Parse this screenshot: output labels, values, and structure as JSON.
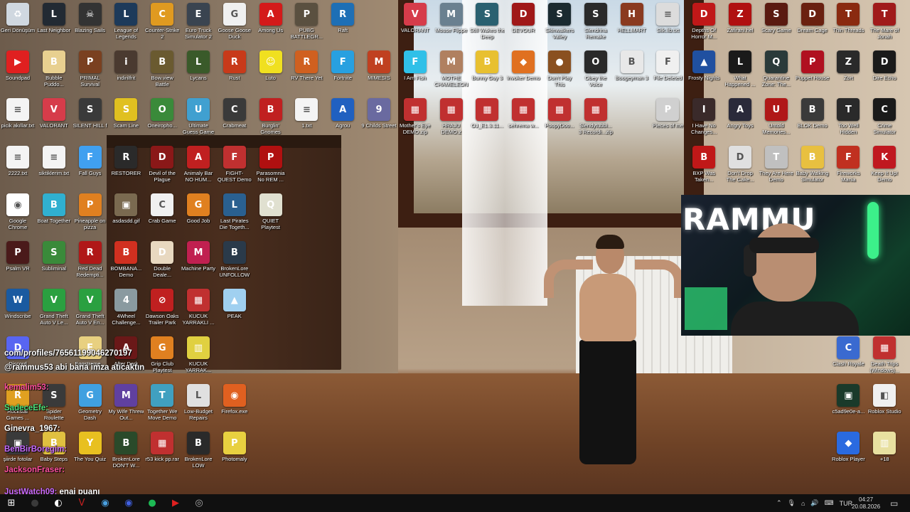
{
  "colors": {
    "taskbar": "#101010",
    "icon_label": "#ffffff",
    "chat_pink": "#ff4fa0",
    "chat_green": "#4be07a",
    "chat_blue": "#4ab0ff",
    "chat_white": "#ffffff",
    "chat_purple": "#c86bff"
  },
  "icons": [
    {
      "label": "Geri Dönüşüm",
      "col": 0,
      "row": 0,
      "color": "#d0d8e0",
      "glyph": "♻"
    },
    {
      "label": "Last Neighbor",
      "col": 1,
      "row": 0,
      "color": "#222a33",
      "glyph": "L"
    },
    {
      "label": "Blazing Sails",
      "col": 2,
      "row": 0,
      "color": "#333",
      "glyph": "☠"
    },
    {
      "label": "League of Legends",
      "col": 3,
      "row": 0,
      "color": "#1d3a5a",
      "glyph": "L"
    },
    {
      "label": "Counter-Strike 2",
      "col": 4,
      "row": 0,
      "color": "#e09a20",
      "glyph": "C"
    },
    {
      "label": "Euro Truck Simulator 2",
      "col": 5,
      "row": 0,
      "color": "#3a4450",
      "glyph": "E"
    },
    {
      "label": "Goose Goose Duck",
      "col": 6,
      "row": 0,
      "color": "#f0f0f0",
      "glyph": "G"
    },
    {
      "label": "Among Us",
      "col": 7,
      "row": 0,
      "color": "#d41a1a",
      "glyph": "A"
    },
    {
      "label": "PUBG BATTLEGR...",
      "col": 8,
      "row": 0,
      "color": "#5a5040",
      "glyph": "P"
    },
    {
      "label": "Raft",
      "col": 9,
      "row": 0,
      "color": "#1e6fb5",
      "glyph": "R"
    },
    {
      "label": "VALORANT",
      "col": 11,
      "row": 0,
      "color": "#d63c4a",
      "glyph": "V"
    },
    {
      "label": "Mouse Flippe",
      "col": 12,
      "row": 0,
      "color": "#6a8090",
      "glyph": "M"
    },
    {
      "label": "Still Wakes the Deep",
      "col": 13,
      "row": 0,
      "color": "#2a6070",
      "glyph": "S"
    },
    {
      "label": "DEVOUR",
      "col": 14,
      "row": 0,
      "color": "#a01818",
      "glyph": "D"
    },
    {
      "label": "Skinwalkers Valley",
      "col": 15,
      "row": 0,
      "color": "#1a2a30",
      "glyph": "S"
    },
    {
      "label": "Slendrina Remake",
      "col": 16,
      "row": 0,
      "color": "#2a2a2a",
      "glyph": "S"
    },
    {
      "label": "HELLMART",
      "col": 17,
      "row": 0,
      "color": "#8a3a20",
      "glyph": "H"
    },
    {
      "label": "Silk.lib.txt",
      "col": 18,
      "row": 0,
      "color": "#dcdcdc",
      "glyph": "≡"
    },
    {
      "label": "Depths Of Horror M...",
      "col": 19,
      "row": 0,
      "color": "#c01818",
      "glyph": "D"
    },
    {
      "label": "Zafirani.hel",
      "col": 20,
      "row": 0,
      "color": "#b01010",
      "glyph": "Z"
    },
    {
      "label": "Scary Game",
      "col": 21,
      "row": 0,
      "color": "#5a1a10",
      "glyph": "S"
    },
    {
      "label": "Dream Cage",
      "col": 22,
      "row": 0,
      "color": "#6a2010",
      "glyph": "D"
    },
    {
      "label": "Thin Threads",
      "col": 23,
      "row": 0,
      "color": "#8a2a10",
      "glyph": "T"
    },
    {
      "label": "The Mare of Jonah",
      "col": 24,
      "row": 0,
      "color": "#a01a1a",
      "glyph": "T"
    },
    {
      "label": "Soundpad",
      "col": 0,
      "row": 1,
      "color": "#e02020",
      "glyph": "▶"
    },
    {
      "label": "Bubble Puddo...",
      "col": 1,
      "row": 1,
      "color": "#e8d090",
      "glyph": "B"
    },
    {
      "label": "PRIMAL Survival",
      "col": 2,
      "row": 1,
      "color": "#7a4020",
      "glyph": "P"
    },
    {
      "label": "indirilfrit",
      "col": 3,
      "row": 1,
      "color": "#4a3a30",
      "glyph": "i"
    },
    {
      "label": "Bow.view Battle",
      "col": 4,
      "row": 1,
      "color": "#6a5a30",
      "glyph": "B"
    },
    {
      "label": "Lycans",
      "col": 5,
      "row": 1,
      "color": "#3a5a2a",
      "glyph": "L"
    },
    {
      "label": "Rust",
      "col": 6,
      "row": 1,
      "color": "#c83a1a",
      "glyph": "R"
    },
    {
      "label": "Luto",
      "col": 7,
      "row": 1,
      "color": "#f0e020",
      "glyph": "☺"
    },
    {
      "label": "RV There Yet",
      "col": 8,
      "row": 1,
      "color": "#d06020",
      "glyph": "R"
    },
    {
      "label": "Fortnite",
      "col": 9,
      "row": 1,
      "color": "#28a0e0",
      "glyph": "F"
    },
    {
      "label": "MIMESIS",
      "col": 10,
      "row": 1,
      "color": "#c04020",
      "glyph": "M"
    },
    {
      "label": "I Am Fish",
      "col": 11,
      "row": 1,
      "color": "#30c0e8",
      "glyph": "F"
    },
    {
      "label": "MOTHE CHAMELEON",
      "col": 12,
      "row": 1,
      "color": "#b08060",
      "glyph": "M"
    },
    {
      "label": "Bunny Guy 3",
      "col": 13,
      "row": 1,
      "color": "#e8c030",
      "glyph": "B"
    },
    {
      "label": "Invoker Demo",
      "col": 14,
      "row": 1,
      "color": "#e07020",
      "glyph": "◆"
    },
    {
      "label": "Don't Play This",
      "col": 15,
      "row": 1,
      "color": "#8a5020",
      "glyph": "●"
    },
    {
      "label": "Obey the Voice",
      "col": 16,
      "row": 1,
      "color": "#2a2a2a",
      "glyph": "O"
    },
    {
      "label": "Boogeyman 3",
      "col": 17,
      "row": 1,
      "color": "#e8e8e8",
      "glyph": "B"
    },
    {
      "label": "File Deleted",
      "col": 18,
      "row": 1,
      "color": "#f0f0f0",
      "glyph": "F"
    },
    {
      "label": "Frosty Nights",
      "col": 19,
      "row": 1,
      "color": "#2050a0",
      "glyph": "▲"
    },
    {
      "label": "What Happened ...",
      "col": 20,
      "row": 1,
      "color": "#1a1a1a",
      "glyph": "L"
    },
    {
      "label": "Quarantine Zone: The...",
      "col": 21,
      "row": 1,
      "color": "#2a3a3a",
      "glyph": "Q"
    },
    {
      "label": "Puppet House",
      "col": 22,
      "row": 1,
      "color": "#b01020",
      "glyph": "P"
    },
    {
      "label": "Zort",
      "col": 23,
      "row": 1,
      "color": "#2a2a2a",
      "glyph": "Z"
    },
    {
      "label": "Dire Echo",
      "col": 24,
      "row": 1,
      "color": "#1a1a1a",
      "glyph": "D"
    },
    {
      "label": "picik akıllar.txt",
      "col": 0,
      "row": 2,
      "color": "#f4f4f4",
      "glyph": "≡"
    },
    {
      "label": "VALORANT",
      "col": 1,
      "row": 2,
      "color": "#d63c4a",
      "glyph": "V"
    },
    {
      "label": "SILENT HILL f",
      "col": 2,
      "row": 2,
      "color": "#3a3a3a",
      "glyph": "S"
    },
    {
      "label": "Scam Line",
      "col": 3,
      "row": 2,
      "color": "#e0c020",
      "glyph": "S"
    },
    {
      "label": "Oneiropho...",
      "col": 4,
      "row": 2,
      "color": "#3a8a3a",
      "glyph": "O"
    },
    {
      "label": "Ultimate Guess Game",
      "col": 5,
      "row": 2,
      "color": "#40a0d0",
      "glyph": "U"
    },
    {
      "label": "Crabmeat",
      "col": 6,
      "row": 2,
      "color": "#3a3a3a",
      "glyph": "C"
    },
    {
      "label": "Burglin' Gnomes",
      "col": 7,
      "row": 2,
      "color": "#c02020",
      "glyph": "B"
    },
    {
      "label": "1.txt",
      "col": 8,
      "row": 2,
      "color": "#f4f4f4",
      "glyph": "≡"
    },
    {
      "label": "Agrou",
      "col": 9,
      "row": 2,
      "color": "#2060c0",
      "glyph": "A"
    },
    {
      "label": "9 Childs Street",
      "col": 10,
      "row": 2,
      "color": "#6a6aa0",
      "glyph": "9"
    },
    {
      "label": "Mother's Eye DEMO.zip",
      "col": 11,
      "row": 2,
      "color": "#c03030",
      "glyph": "▦"
    },
    {
      "label": "HRAJU DEMO.z",
      "col": 12,
      "row": 2,
      "color": "#c03030",
      "glyph": "▦"
    },
    {
      "label": "OJ_E1.3.11...",
      "col": 13,
      "row": 2,
      "color": "#c03030",
      "glyph": "▦"
    },
    {
      "label": "sehrema w...",
      "col": 14,
      "row": 2,
      "color": "#c03030",
      "glyph": "▦"
    },
    {
      "label": "PoopyDoo...",
      "col": 15,
      "row": 2,
      "color": "#c03030",
      "glyph": "▦"
    },
    {
      "label": "Slendytubbi... 3 Recordi...zip",
      "col": 16,
      "row": 2,
      "color": "#c03030",
      "glyph": "▦"
    },
    {
      "label": "Pieces of me",
      "col": 18,
      "row": 2,
      "color": "#d0d0d0",
      "glyph": "P"
    },
    {
      "label": "I Have No Changes...",
      "col": 19,
      "row": 2,
      "color": "#3a2a2a",
      "glyph": "I"
    },
    {
      "label": "Angry Toys",
      "col": 20,
      "row": 2,
      "color": "#2a2a3a",
      "glyph": "A"
    },
    {
      "label": "Untold Memories...",
      "col": 21,
      "row": 2,
      "color": "#b01818",
      "glyph": "U"
    },
    {
      "label": "BLOK Demo",
      "col": 22,
      "row": 2,
      "color": "#3a3a3a",
      "glyph": "B"
    },
    {
      "label": "Too Well Hidden",
      "col": 23,
      "row": 2,
      "color": "#2a2a2a",
      "glyph": "T"
    },
    {
      "label": "Crime Simulator",
      "col": 24,
      "row": 2,
      "color": "#1a1a1a",
      "glyph": "C"
    },
    {
      "label": "2222.txt",
      "col": 0,
      "row": 3,
      "color": "#f4f4f4",
      "glyph": "≡"
    },
    {
      "label": "siktiklerim.txt",
      "col": 1,
      "row": 3,
      "color": "#f4f4f4",
      "glyph": "≡"
    },
    {
      "label": "Fall Guys",
      "col": 2,
      "row": 3,
      "color": "#40a0f0",
      "glyph": "F"
    },
    {
      "label": "RESTORER",
      "col": 3,
      "row": 3,
      "color": "#2a2a2a",
      "glyph": "R"
    },
    {
      "label": "Devil of the Plague",
      "col": 4,
      "row": 3,
      "color": "#8a1818",
      "glyph": "D"
    },
    {
      "label": "Animaly Bar NO HUM...",
      "col": 5,
      "row": 3,
      "color": "#c02020",
      "glyph": "A"
    },
    {
      "label": "FIGHT-QUEST Demo",
      "col": 6,
      "row": 3,
      "color": "#c03030",
      "glyph": "F"
    },
    {
      "label": "Parasomnia No REM ...",
      "col": 7,
      "row": 3,
      "color": "#b01010",
      "glyph": "P"
    },
    {
      "label": "BXP Was Taken...",
      "col": 19,
      "row": 3,
      "color": "#c01818",
      "glyph": "B"
    },
    {
      "label": "Don't Drop The Cake...",
      "col": 20,
      "row": 3,
      "color": "#e0e0e0",
      "glyph": "D"
    },
    {
      "label": "They Are Here Demo",
      "col": 21,
      "row": 3,
      "color": "#c0c0c0",
      "glyph": "T"
    },
    {
      "label": "Baby Walking Simulator",
      "col": 22,
      "row": 3,
      "color": "#e8c040",
      "glyph": "B"
    },
    {
      "label": "Fireworks Mania",
      "col": 23,
      "row": 3,
      "color": "#c03020",
      "glyph": "F"
    },
    {
      "label": "Keep It Up! Demo",
      "col": 24,
      "row": 3,
      "color": "#c01820",
      "glyph": "K"
    },
    {
      "label": "Google Chrome",
      "col": 0,
      "row": 4,
      "color": "#ffffff",
      "glyph": "◉"
    },
    {
      "label": "Boat Together",
      "col": 1,
      "row": 4,
      "color": "#30b0d0",
      "glyph": "B"
    },
    {
      "label": "Pineapple on pizza",
      "col": 2,
      "row": 4,
      "color": "#e08020",
      "glyph": "P"
    },
    {
      "label": "asdasdd.gif",
      "col": 3,
      "row": 4,
      "color": "#7a6a50",
      "glyph": "▣"
    },
    {
      "label": "Crab Game",
      "col": 4,
      "row": 4,
      "color": "#f0f0f0",
      "glyph": "C"
    },
    {
      "label": "Good Job",
      "col": 5,
      "row": 4,
      "color": "#e08020",
      "glyph": "G"
    },
    {
      "label": "Last Pirates Die Togeth...",
      "col": 6,
      "row": 4,
      "color": "#2a6090",
      "glyph": "L"
    },
    {
      "label": "QUIET Playtest",
      "col": 7,
      "row": 4,
      "color": "#e0e0d0",
      "glyph": "Q"
    },
    {
      "label": "Psalm VR",
      "col": 0,
      "row": 5,
      "color": "#4a1a1a",
      "glyph": "P"
    },
    {
      "label": "Subliminal",
      "col": 1,
      "row": 5,
      "color": "#3a8a3a",
      "glyph": "S"
    },
    {
      "label": "Red Dead Redempti...",
      "col": 2,
      "row": 5,
      "color": "#b01818",
      "glyph": "R"
    },
    {
      "label": "BOMBANA... Demo",
      "col": 3,
      "row": 5,
      "color": "#d03020",
      "glyph": "B"
    },
    {
      "label": "Double Deale...",
      "col": 4,
      "row": 5,
      "color": "#e8d8c0",
      "glyph": "D"
    },
    {
      "label": "Machine Party",
      "col": 5,
      "row": 5,
      "color": "#c02050",
      "glyph": "M"
    },
    {
      "label": "BrokenLore UNFOLLOW",
      "col": 6,
      "row": 5,
      "color": "#2a3a4a",
      "glyph": "B"
    },
    {
      "label": "Windscribe",
      "col": 0,
      "row": 6,
      "color": "#1a5aa0",
      "glyph": "W"
    },
    {
      "label": "Grand Theft Auto V Le...",
      "col": 1,
      "row": 6,
      "color": "#2aa040",
      "glyph": "V"
    },
    {
      "label": "Grand Theft Auto V En...",
      "col": 2,
      "row": 6,
      "color": "#2aa040",
      "glyph": "V"
    },
    {
      "label": "4Wheel Challenge...",
      "col": 3,
      "row": 6,
      "color": "#8a9aa0",
      "glyph": "4"
    },
    {
      "label": "Dawson Oaks Trailer Park",
      "col": 4,
      "row": 6,
      "color": "#c02020",
      "glyph": "⊘"
    },
    {
      "label": "KUCUK YARRAKLI ...",
      "col": 5,
      "row": 6,
      "color": "#c03030",
      "glyph": "▦"
    },
    {
      "label": "PEAK",
      "col": 6,
      "row": 6,
      "color": "#a0d0f0",
      "glyph": "▲"
    },
    {
      "label": "Discord",
      "col": 0,
      "row": 7,
      "color": "#5865f2",
      "glyph": "D"
    },
    {
      "label": "Eggstreme...",
      "col": 2,
      "row": 7,
      "color": "#e8d080",
      "glyph": "E"
    },
    {
      "label": "After Dark",
      "col": 3,
      "row": 7,
      "color": "#6a1818",
      "glyph": "A"
    },
    {
      "label": "Grip Club Playtest",
      "col": 4,
      "row": 7,
      "color": "#e08020",
      "glyph": "G"
    },
    {
      "label": "KUCUK YARRAK...",
      "col": 5,
      "row": 7,
      "color": "#e0d040",
      "glyph": "▥"
    },
    {
      "label": "Rockstar Games ...",
      "col": 0,
      "row": 8,
      "color": "#e0a020",
      "glyph": "R"
    },
    {
      "label": "Spider Roulette",
      "col": 1,
      "row": 8,
      "color": "#3a3a3a",
      "glyph": "S"
    },
    {
      "label": "Geometry Dash",
      "col": 2,
      "row": 8,
      "color": "#40a0e0",
      "glyph": "G"
    },
    {
      "label": "My Wife Threw Out...",
      "col": 3,
      "row": 8,
      "color": "#6040a0",
      "glyph": "M"
    },
    {
      "label": "Together We Move Demo",
      "col": 4,
      "row": 8,
      "color": "#40a0c0",
      "glyph": "T"
    },
    {
      "label": "Low-Budget Repairs",
      "col": 5,
      "row": 8,
      "color": "#e0e0e0",
      "glyph": "L"
    },
    {
      "label": "Firefox.exe",
      "col": 6,
      "row": 8,
      "color": "#e06020",
      "glyph": "◉"
    },
    {
      "label": "şiirde fotolar",
      "col": 0,
      "row": 9,
      "color": "#3a3a3a",
      "glyph": "▣"
    },
    {
      "label": "Baby Steps",
      "col": 1,
      "row": 9,
      "color": "#e0c040",
      "glyph": "B"
    },
    {
      "label": "The You Quiz",
      "col": 2,
      "row": 9,
      "color": "#e8c020",
      "glyph": "Y"
    },
    {
      "label": "BrokenLore DON'T W...",
      "col": 3,
      "row": 9,
      "color": "#2a4a2a",
      "glyph": "B"
    },
    {
      "label": "r53 kick pp.rar",
      "col": 4,
      "row": 9,
      "color": "#c03030",
      "glyph": "▦"
    },
    {
      "label": "BrokenLore LOW",
      "col": 5,
      "row": 9,
      "color": "#2a2a2a",
      "glyph": "B"
    },
    {
      "label": "Photomaly",
      "col": 6,
      "row": 9,
      "color": "#e8d040",
      "glyph": "P"
    },
    {
      "label": "Clash Royale",
      "col": 23,
      "row": 7,
      "color": "#3a6ad0",
      "glyph": "C"
    },
    {
      "label": "Death Trips (Windows)...",
      "col": 24,
      "row": 7,
      "color": "#c03030",
      "glyph": "▦"
    },
    {
      "label": "c5ad9e0e-a...",
      "col": 23,
      "row": 8,
      "color": "#1a3a2a",
      "glyph": "▣"
    },
    {
      "label": "Roblox Studio",
      "col": 24,
      "row": 8,
      "color": "#f0f0f0",
      "glyph": "◧"
    },
    {
      "label": "Roblox Player",
      "col": 23,
      "row": 9,
      "color": "#2a6ae0",
      "glyph": "◆"
    },
    {
      "label": "+18",
      "col": 24,
      "row": 9,
      "color": "#e8e0a0",
      "glyph": "▥"
    }
  ],
  "webcam": {
    "overlay_text": "RAMMU"
  },
  "chat": [
    {
      "user": "",
      "text": "com/profiles/76561199046270197",
      "color": "#ffffff"
    },
    {
      "user": "",
      "text": "@rammus53 abi bana imza atıcaktın",
      "color": "#ffffff"
    },
    {
      "user": "kemalim53:",
      "text": "",
      "color": "#ff4fa0"
    },
    {
      "user": "SadeceEfe:",
      "text": "",
      "color": "#4be07a"
    },
    {
      "user": "Ginevra_1967:",
      "text": "",
      "color": "#ffffff"
    },
    {
      "user": "BenBirBoregim:",
      "text": "",
      "color": "#c86bff"
    },
    {
      "user": "JacksonFraser:",
      "text": "",
      "color": "#ff4fa0"
    },
    {
      "user": "JustWatch09:",
      "text": "enai puanı",
      "color": "#c86bff"
    }
  ],
  "taskbar": {
    "apps": [
      {
        "name": "start-button",
        "glyph": "⊞",
        "color": "#ffffff"
      },
      {
        "name": "obs-icon",
        "glyph": "●",
        "color": "#3a3a3a"
      },
      {
        "name": "steam-icon",
        "glyph": "◐",
        "color": "#ffffff"
      },
      {
        "name": "vpn-icon",
        "glyph": "V",
        "color": "#c02020"
      },
      {
        "name": "chrome-icon",
        "glyph": "◉",
        "color": "#4aa0e0"
      },
      {
        "name": "browser-icon",
        "glyph": "◉",
        "color": "#4060e0"
      },
      {
        "name": "spotify-icon",
        "glyph": "●",
        "color": "#1db954"
      },
      {
        "name": "youtube-icon",
        "glyph": "▶",
        "color": "#e02020"
      },
      {
        "name": "app-icon",
        "glyph": "◎",
        "color": "#aaaaaa"
      }
    ],
    "language": "TUR",
    "time": "04:27",
    "date": "20.08.2026"
  }
}
